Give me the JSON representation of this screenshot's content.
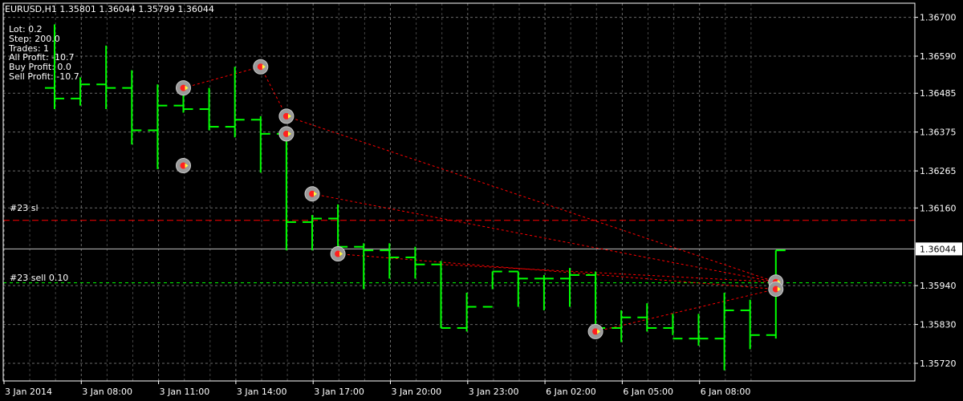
{
  "header": {
    "symbol_line": "EURUSD,H1  1.35801 1.36044 1.35799 1.36044"
  },
  "info_panel": [
    "Lot: 0.2",
    "Step: 200.0",
    "Trades: 1",
    "All Profit: -10.7",
    "Buy Profit: 0.0",
    "Sell Profit: -10.7"
  ],
  "colors": {
    "background": "#000000",
    "bars": "#00ff00",
    "grid": "#c0c0c0",
    "sl_line": "#ff0000",
    "order_line": "#00ff00",
    "trade_link": "#ff0000",
    "axis": "#ffffff"
  },
  "chart_data": {
    "type": "ohlc",
    "symbol": "EURUSD",
    "timeframe": "H1",
    "current_price": 1.36044,
    "current_price_label": "1.36044",
    "ylim": [
      1.3567,
      1.3674
    ],
    "yticks": [
      1.367,
      1.3659,
      1.36485,
      1.36375,
      1.36265,
      1.3616,
      1.3594,
      1.3583,
      1.3572
    ],
    "ytick_labels": [
      "1.36700",
      "1.36590",
      "1.36485",
      "1.36375",
      "1.36265",
      "1.36160",
      "1.35940",
      "1.35830",
      "1.35720"
    ],
    "xticks": [
      {
        "bar": 0,
        "label": "3 Jan 2014"
      },
      {
        "bar": 3,
        "label": "3 Jan 08:00"
      },
      {
        "bar": 6,
        "label": "3 Jan 11:00"
      },
      {
        "bar": 9,
        "label": "3 Jan 14:00"
      },
      {
        "bar": 12,
        "label": "3 Jan 17:00"
      },
      {
        "bar": 15,
        "label": "3 Jan 20:00"
      },
      {
        "bar": 18,
        "label": "3 Jan 23:00"
      },
      {
        "bar": 21,
        "label": "6 Jan 02:00"
      },
      {
        "bar": 24,
        "label": "6 Jan 05:00"
      },
      {
        "bar": 27,
        "label": "6 Jan 08:00"
      }
    ],
    "grid": true,
    "bars": [
      {
        "o": 1.365,
        "h": 1.3668,
        "l": 1.3644,
        "c": 1.3647
      },
      {
        "o": 1.3647,
        "h": 1.3653,
        "l": 1.3645,
        "c": 1.3651
      },
      {
        "o": 1.3651,
        "h": 1.3662,
        "l": 1.3644,
        "c": 1.365
      },
      {
        "o": 1.365,
        "h": 1.3655,
        "l": 1.3634,
        "c": 1.3638
      },
      {
        "o": 1.3638,
        "h": 1.3651,
        "l": 1.3627,
        "c": 1.3645
      },
      {
        "o": 1.3645,
        "h": 1.3652,
        "l": 1.3643,
        "c": 1.3644
      },
      {
        "o": 1.3644,
        "h": 1.365,
        "l": 1.3638,
        "c": 1.3639
      },
      {
        "o": 1.3639,
        "h": 1.3656,
        "l": 1.3636,
        "c": 1.3641
      },
      {
        "o": 1.3641,
        "h": 1.3642,
        "l": 1.3626,
        "c": 1.3637
      },
      {
        "o": 1.3637,
        "h": 1.3638,
        "l": 1.3604,
        "c": 1.3612
      },
      {
        "o": 1.3612,
        "h": 1.3614,
        "l": 1.3604,
        "c": 1.3613
      },
      {
        "o": 1.3613,
        "h": 1.3617,
        "l": 1.3605,
        "c": 1.3605
      },
      {
        "o": 1.3605,
        "h": 1.3606,
        "l": 1.3593,
        "c": 1.3604
      },
      {
        "o": 1.3604,
        "h": 1.3606,
        "l": 1.3596,
        "c": 1.3602
      },
      {
        "o": 1.3602,
        "h": 1.3605,
        "l": 1.3596,
        "c": 1.36
      },
      {
        "o": 1.36,
        "h": 1.3601,
        "l": 1.3582,
        "c": 1.3582
      },
      {
        "o": 1.3582,
        "h": 1.3592,
        "l": 1.3581,
        "c": 1.3588
      },
      {
        "o": 1.3588,
        "h": 1.3598,
        "l": 1.3593,
        "c": 1.3598
      },
      {
        "o": 1.3598,
        "h": 1.3598,
        "l": 1.3588,
        "c": 1.3596
      },
      {
        "o": 1.3596,
        "h": 1.3597,
        "l": 1.3587,
        "c": 1.3596
      },
      {
        "o": 1.3596,
        "h": 1.3599,
        "l": 1.3588,
        "c": 1.3597
      },
      {
        "o": 1.3597,
        "h": 1.3598,
        "l": 1.358,
        "c": 1.3582
      },
      {
        "o": 1.3582,
        "h": 1.3587,
        "l": 1.3578,
        "c": 1.3585
      },
      {
        "o": 1.3585,
        "h": 1.3589,
        "l": 1.3581,
        "c": 1.3582
      },
      {
        "o": 1.3582,
        "h": 1.3586,
        "l": 1.358,
        "c": 1.3579
      },
      {
        "o": 1.3579,
        "h": 1.3586,
        "l": 1.3577,
        "c": 1.3579
      },
      {
        "o": 1.3579,
        "h": 1.3592,
        "l": 1.357,
        "c": 1.3587
      },
      {
        "o": 1.3587,
        "h": 1.359,
        "l": 1.3576,
        "c": 1.358
      },
      {
        "o": 1.358,
        "h": 1.3604,
        "l": 1.3579,
        "c": 1.3604
      }
    ],
    "price_lines": [
      {
        "label": "#23 sl",
        "price": 1.36125,
        "style": "sl"
      },
      {
        "label": "#23 sell 0.10",
        "price": 1.35948,
        "style": "order"
      }
    ],
    "trade_markers": [
      {
        "bar": 5,
        "price": 1.365,
        "kind": "open"
      },
      {
        "bar": 5,
        "price": 1.3628,
        "kind": "open"
      },
      {
        "bar": 8,
        "price": 1.3656,
        "kind": "open"
      },
      {
        "bar": 9,
        "price": 1.3642,
        "kind": "open"
      },
      {
        "bar": 9,
        "price": 1.3637,
        "kind": "open"
      },
      {
        "bar": 10,
        "price": 1.362,
        "kind": "open"
      },
      {
        "bar": 11,
        "price": 1.3603,
        "kind": "open"
      },
      {
        "bar": 21,
        "price": 1.3581,
        "kind": "open"
      },
      {
        "bar": 28,
        "price": 1.3595,
        "kind": "close"
      },
      {
        "bar": 28,
        "price": 1.3593,
        "kind": "close"
      }
    ],
    "trade_links": [
      {
        "from": [
          5,
          1.365
        ],
        "to": [
          8,
          1.3656
        ]
      },
      {
        "from": [
          8,
          1.3656
        ],
        "to": [
          9,
          1.3642
        ]
      },
      {
        "from": [
          9,
          1.3642
        ],
        "to": [
          28,
          1.3595
        ]
      },
      {
        "from": [
          10,
          1.362
        ],
        "to": [
          28,
          1.3595
        ]
      },
      {
        "from": [
          11,
          1.3603
        ],
        "to": [
          28,
          1.3593
        ]
      },
      {
        "from": [
          21,
          1.3581
        ],
        "to": [
          28,
          1.3593
        ]
      },
      {
        "from": [
          15,
          1.36
        ],
        "to": [
          28,
          1.3595
        ]
      }
    ]
  }
}
